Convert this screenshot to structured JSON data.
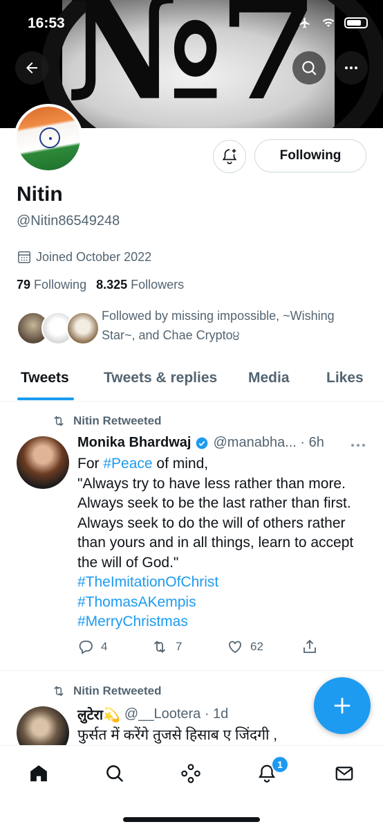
{
  "status_bar": {
    "time": "16:53"
  },
  "banner": {
    "logo_text": "№7"
  },
  "profile": {
    "follow_button": "Following",
    "name": "Nitin",
    "handle": "@Nitin86549248",
    "joined": "Joined October 2022",
    "following_count": "79",
    "following_label": "Following",
    "followers_count": "8.325",
    "followers_label": "Followers",
    "followed_by": "Followed by missing impossible, ~Wishing Star~, and Chae Crypto੪"
  },
  "tabs": [
    {
      "label": "Tweets"
    },
    {
      "label": "Tweets & replies"
    },
    {
      "label": "Media"
    },
    {
      "label": "Likes"
    }
  ],
  "tweets": [
    {
      "retweet_label": "Nitin Retweeted",
      "name": "Monika Bhardwaj",
      "meta": "@manabha... · 6h",
      "body_1": "For ",
      "tag_1": "#Peace",
      "body_2": " of mind,",
      "body_3": "\"Always try to have less rather than more. Always seek to be the last rather than first. Always seek to do the will of others rather than yours and in all things, learn to accept the will of God.\"",
      "tag_2": "#TheImitationOfChrist",
      "tag_3": "#ThomasAKempis",
      "tag_4": "#MerryChristmas",
      "replies": "4",
      "retweets": "7",
      "likes": "62"
    },
    {
      "retweet_label": "Nitin Retweeted",
      "name": "लुटेरा💫",
      "meta": "@__Lootera · 1d",
      "body_1": "फुर्सत में करेंगे तुजसे हिसाब ए जिंदगी ,"
    }
  ],
  "nav": {
    "notification_count": "1"
  },
  "colors": {
    "accent": "#1d9bf0",
    "text": "#0f1419",
    "muted": "#536471"
  }
}
